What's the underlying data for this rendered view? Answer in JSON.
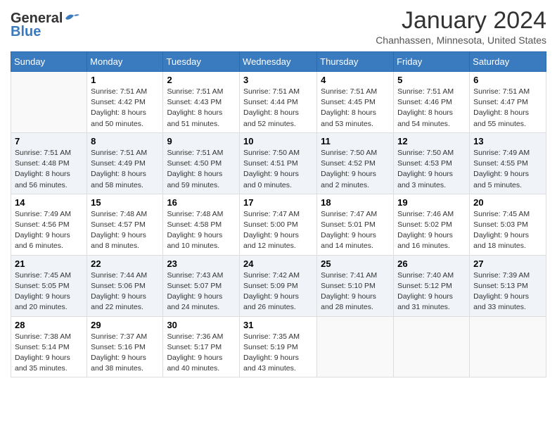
{
  "header": {
    "logo_line1": "General",
    "logo_line2": "Blue",
    "month": "January 2024",
    "location": "Chanhassen, Minnesota, United States"
  },
  "weekdays": [
    "Sunday",
    "Monday",
    "Tuesday",
    "Wednesday",
    "Thursday",
    "Friday",
    "Saturday"
  ],
  "weeks": [
    [
      {
        "day": "",
        "info": ""
      },
      {
        "day": "1",
        "info": "Sunrise: 7:51 AM\nSunset: 4:42 PM\nDaylight: 8 hours\nand 50 minutes."
      },
      {
        "day": "2",
        "info": "Sunrise: 7:51 AM\nSunset: 4:43 PM\nDaylight: 8 hours\nand 51 minutes."
      },
      {
        "day": "3",
        "info": "Sunrise: 7:51 AM\nSunset: 4:44 PM\nDaylight: 8 hours\nand 52 minutes."
      },
      {
        "day": "4",
        "info": "Sunrise: 7:51 AM\nSunset: 4:45 PM\nDaylight: 8 hours\nand 53 minutes."
      },
      {
        "day": "5",
        "info": "Sunrise: 7:51 AM\nSunset: 4:46 PM\nDaylight: 8 hours\nand 54 minutes."
      },
      {
        "day": "6",
        "info": "Sunrise: 7:51 AM\nSunset: 4:47 PM\nDaylight: 8 hours\nand 55 minutes."
      }
    ],
    [
      {
        "day": "7",
        "info": "Sunrise: 7:51 AM\nSunset: 4:48 PM\nDaylight: 8 hours\nand 56 minutes."
      },
      {
        "day": "8",
        "info": "Sunrise: 7:51 AM\nSunset: 4:49 PM\nDaylight: 8 hours\nand 58 minutes."
      },
      {
        "day": "9",
        "info": "Sunrise: 7:51 AM\nSunset: 4:50 PM\nDaylight: 8 hours\nand 59 minutes."
      },
      {
        "day": "10",
        "info": "Sunrise: 7:50 AM\nSunset: 4:51 PM\nDaylight: 9 hours\nand 0 minutes."
      },
      {
        "day": "11",
        "info": "Sunrise: 7:50 AM\nSunset: 4:52 PM\nDaylight: 9 hours\nand 2 minutes."
      },
      {
        "day": "12",
        "info": "Sunrise: 7:50 AM\nSunset: 4:53 PM\nDaylight: 9 hours\nand 3 minutes."
      },
      {
        "day": "13",
        "info": "Sunrise: 7:49 AM\nSunset: 4:55 PM\nDaylight: 9 hours\nand 5 minutes."
      }
    ],
    [
      {
        "day": "14",
        "info": "Sunrise: 7:49 AM\nSunset: 4:56 PM\nDaylight: 9 hours\nand 6 minutes."
      },
      {
        "day": "15",
        "info": "Sunrise: 7:48 AM\nSunset: 4:57 PM\nDaylight: 9 hours\nand 8 minutes."
      },
      {
        "day": "16",
        "info": "Sunrise: 7:48 AM\nSunset: 4:58 PM\nDaylight: 9 hours\nand 10 minutes."
      },
      {
        "day": "17",
        "info": "Sunrise: 7:47 AM\nSunset: 5:00 PM\nDaylight: 9 hours\nand 12 minutes."
      },
      {
        "day": "18",
        "info": "Sunrise: 7:47 AM\nSunset: 5:01 PM\nDaylight: 9 hours\nand 14 minutes."
      },
      {
        "day": "19",
        "info": "Sunrise: 7:46 AM\nSunset: 5:02 PM\nDaylight: 9 hours\nand 16 minutes."
      },
      {
        "day": "20",
        "info": "Sunrise: 7:45 AM\nSunset: 5:03 PM\nDaylight: 9 hours\nand 18 minutes."
      }
    ],
    [
      {
        "day": "21",
        "info": "Sunrise: 7:45 AM\nSunset: 5:05 PM\nDaylight: 9 hours\nand 20 minutes."
      },
      {
        "day": "22",
        "info": "Sunrise: 7:44 AM\nSunset: 5:06 PM\nDaylight: 9 hours\nand 22 minutes."
      },
      {
        "day": "23",
        "info": "Sunrise: 7:43 AM\nSunset: 5:07 PM\nDaylight: 9 hours\nand 24 minutes."
      },
      {
        "day": "24",
        "info": "Sunrise: 7:42 AM\nSunset: 5:09 PM\nDaylight: 9 hours\nand 26 minutes."
      },
      {
        "day": "25",
        "info": "Sunrise: 7:41 AM\nSunset: 5:10 PM\nDaylight: 9 hours\nand 28 minutes."
      },
      {
        "day": "26",
        "info": "Sunrise: 7:40 AM\nSunset: 5:12 PM\nDaylight: 9 hours\nand 31 minutes."
      },
      {
        "day": "27",
        "info": "Sunrise: 7:39 AM\nSunset: 5:13 PM\nDaylight: 9 hours\nand 33 minutes."
      }
    ],
    [
      {
        "day": "28",
        "info": "Sunrise: 7:38 AM\nSunset: 5:14 PM\nDaylight: 9 hours\nand 35 minutes."
      },
      {
        "day": "29",
        "info": "Sunrise: 7:37 AM\nSunset: 5:16 PM\nDaylight: 9 hours\nand 38 minutes."
      },
      {
        "day": "30",
        "info": "Sunrise: 7:36 AM\nSunset: 5:17 PM\nDaylight: 9 hours\nand 40 minutes."
      },
      {
        "day": "31",
        "info": "Sunrise: 7:35 AM\nSunset: 5:19 PM\nDaylight: 9 hours\nand 43 minutes."
      },
      {
        "day": "",
        "info": ""
      },
      {
        "day": "",
        "info": ""
      },
      {
        "day": "",
        "info": ""
      }
    ]
  ]
}
